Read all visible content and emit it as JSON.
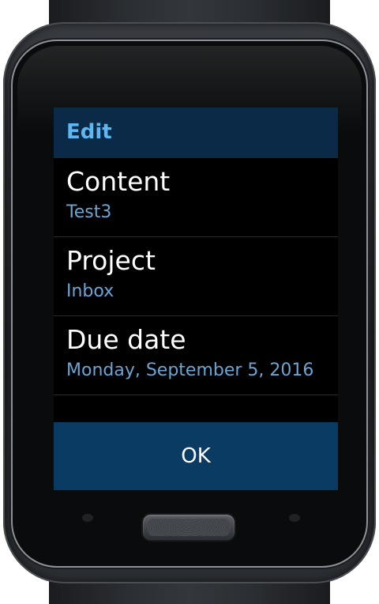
{
  "header": {
    "title": "Edit"
  },
  "items": [
    {
      "label": "Content",
      "value": "Test3"
    },
    {
      "label": "Project",
      "value": "Inbox"
    },
    {
      "label": "Due date",
      "value": "Monday, September 5, 2016"
    }
  ],
  "ok_button": {
    "label": "OK"
  },
  "colors": {
    "header_bg": "#0a2a47",
    "header_text": "#5db7f2",
    "value_text": "#6aa5d4",
    "button_bg": "#0a3b63",
    "screen_bg": "#000000"
  }
}
